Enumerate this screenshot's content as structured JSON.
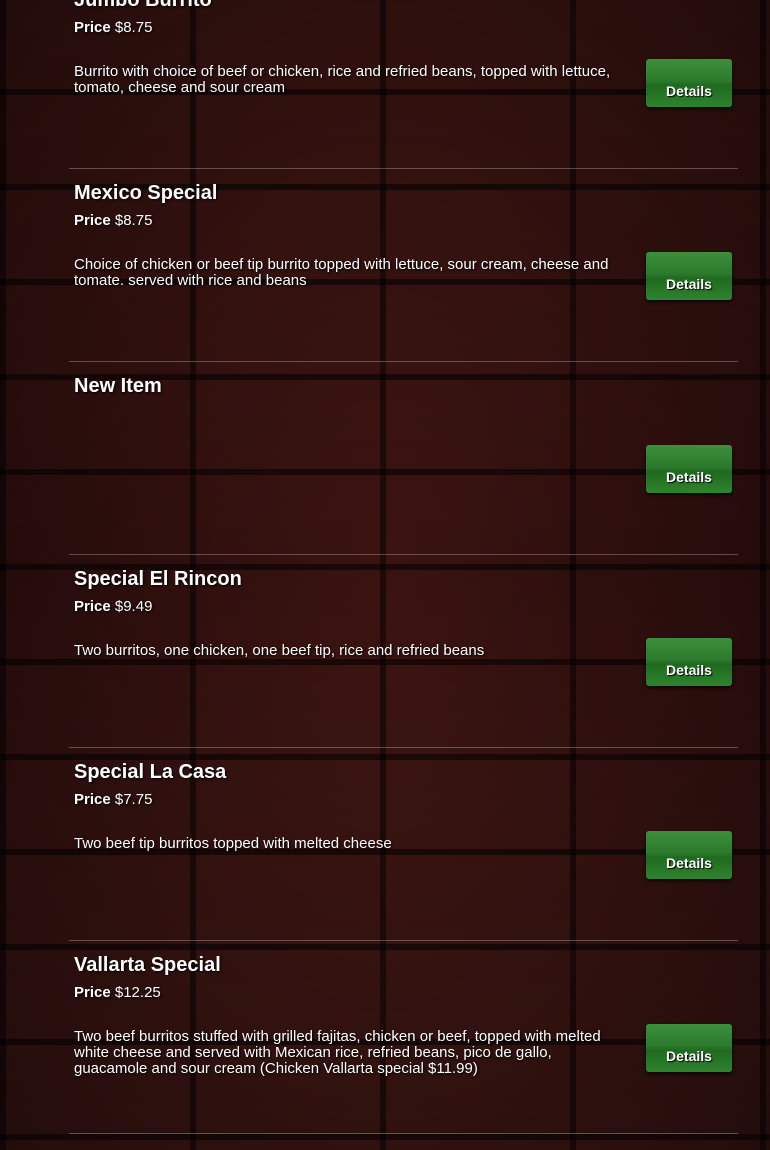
{
  "menu": {
    "details_label": "Details",
    "price_label": "Price",
    "items": [
      {
        "name": "Jumbo Burrito",
        "price": "$8.75",
        "description": "Burrito with choice of beef or chicken, rice and refried beans, topped with lettuce, tomato, cheese and sour cream"
      },
      {
        "name": "Mexico Special",
        "price": "$8.75",
        "description": "Choice of chicken or beef tip  burrito topped with lettuce, sour cream, cheese and tomate. served with rice and beans"
      },
      {
        "name": "New Item",
        "price": "",
        "description": ""
      },
      {
        "name": "Special El Rincon",
        "price": "$9.49",
        "description": "Two burritos, one chicken, one beef tip, rice and refried beans"
      },
      {
        "name": "Special La Casa",
        "price": "$7.75",
        "description": "Two beef tip burritos topped with melted cheese"
      },
      {
        "name": "Vallarta Special",
        "price": "$12.25",
        "description": "Two beef burritos stuffed with grilled fajitas, chicken or beef, topped with melted white cheese and served with Mexican rice, refried beans, pico de gallo, guacamole and sour cream   (Chicken Vallarta special $11.99)"
      }
    ]
  },
  "colors": {
    "button_green": "#2c7a2c",
    "text": "#ffffff",
    "background_brick": "#3a1311"
  }
}
